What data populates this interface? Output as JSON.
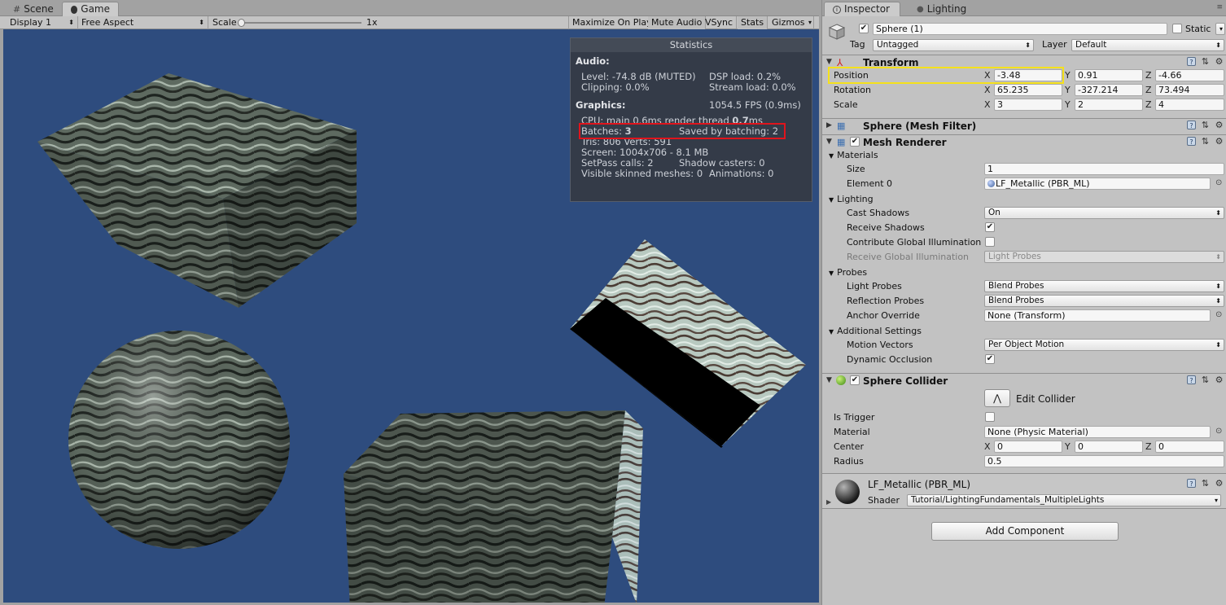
{
  "left_tabs": [
    {
      "label": "Scene",
      "icon": "grid-icon",
      "active": false
    },
    {
      "label": "Game",
      "icon": "pacman-icon",
      "active": true
    }
  ],
  "game_toolbar": {
    "display": "Display 1",
    "aspect": "Free Aspect",
    "scale_label": "Scale",
    "scale_value": "1x",
    "scale_fraction": 0.0,
    "buttons": [
      "Maximize On Play",
      "Mute Audio",
      "VSync",
      "Stats",
      "Gizmos"
    ]
  },
  "stats": {
    "title": "Statistics",
    "audio_head": "Audio:",
    "level": "Level: -74.8 dB (MUTED)",
    "dsp": "DSP load: 0.2%",
    "clipping": "Clipping: 0.0%",
    "stream": "Stream load: 0.0%",
    "graphics_head": "Graphics:",
    "fps": "1054.5 FPS (0.9ms)",
    "cpu_a": "CPU: main",
    "cpu_b": "0.6",
    "cpu_c": "ms  render thread",
    "cpu_d": "0.7",
    "cpu_e": "ms",
    "batches_a": "Batches:",
    "batches_b": "3",
    "saved": "Saved by batching: 2",
    "tris": "Tris: 806  Verts: 591",
    "screen": "Screen: 1004x706 - 8.1 MB",
    "setpass": "SetPass calls: 2",
    "shadow_casters": "Shadow casters: 0",
    "skinned": "Visible skinned meshes: 0",
    "animations": "Animations: 0"
  },
  "inspector": {
    "tabs": [
      {
        "label": "Inspector",
        "icon": "info-icon",
        "active": true
      },
      {
        "label": "Lighting",
        "icon": "bulb-icon",
        "active": false
      }
    ],
    "object_name": "Sphere (1)",
    "static_label": "Static",
    "tag_label": "Tag",
    "tag_value": "Untagged",
    "layer_label": "Layer",
    "layer_value": "Default",
    "transform": {
      "title": "Transform",
      "position_label": "Position",
      "rotation_label": "Rotation",
      "scale_label": "Scale",
      "position": {
        "x": "-3.48",
        "y": "0.91",
        "z": "-4.66"
      },
      "rotation": {
        "x": "65.235",
        "y": "-327.214",
        "z": "73.494"
      },
      "scale": {
        "x": "3",
        "y": "2",
        "z": "4"
      }
    },
    "mesh_filter": {
      "title": "Sphere (Mesh Filter)"
    },
    "mesh_renderer": {
      "title": "Mesh Renderer",
      "materials_head": "Materials",
      "size_label": "Size",
      "size_value": "1",
      "element0_label": "Element 0",
      "element0_value": "LF_Metallic (PBR_ML)",
      "lighting_head": "Lighting",
      "cast_shadows_label": "Cast Shadows",
      "cast_shadows_value": "On",
      "receive_shadows_label": "Receive Shadows",
      "contribute_gi_label": "Contribute Global Illumination",
      "receive_gi_label": "Receive Global Illumination",
      "receive_gi_value": "Light Probes",
      "probes_head": "Probes",
      "light_probes_label": "Light Probes",
      "light_probes_value": "Blend Probes",
      "reflection_probes_label": "Reflection Probes",
      "reflection_probes_value": "Blend Probes",
      "anchor_label": "Anchor Override",
      "anchor_value": "None (Transform)",
      "additional_head": "Additional Settings",
      "motion_label": "Motion Vectors",
      "motion_value": "Per Object Motion",
      "dynamic_occlusion_label": "Dynamic Occlusion"
    },
    "sphere_collider": {
      "title": "Sphere Collider",
      "edit_label": "Edit Collider",
      "is_trigger_label": "Is Trigger",
      "material_label": "Material",
      "material_value": "None (Physic Material)",
      "center_label": "Center",
      "center": {
        "x": "0",
        "y": "0",
        "z": "0"
      },
      "radius_label": "Radius",
      "radius_value": "0.5"
    },
    "material": {
      "name": "LF_Metallic (PBR_ML)",
      "shader_label": "Shader",
      "shader_value": "Tutorial/LightingFundamentals_MultipleLights"
    },
    "add_component": "Add Component"
  },
  "colors": {
    "scene_bg": "#2e4c7e",
    "highlight_yellow": "#f5e11b",
    "highlight_red": "#e0141c"
  }
}
